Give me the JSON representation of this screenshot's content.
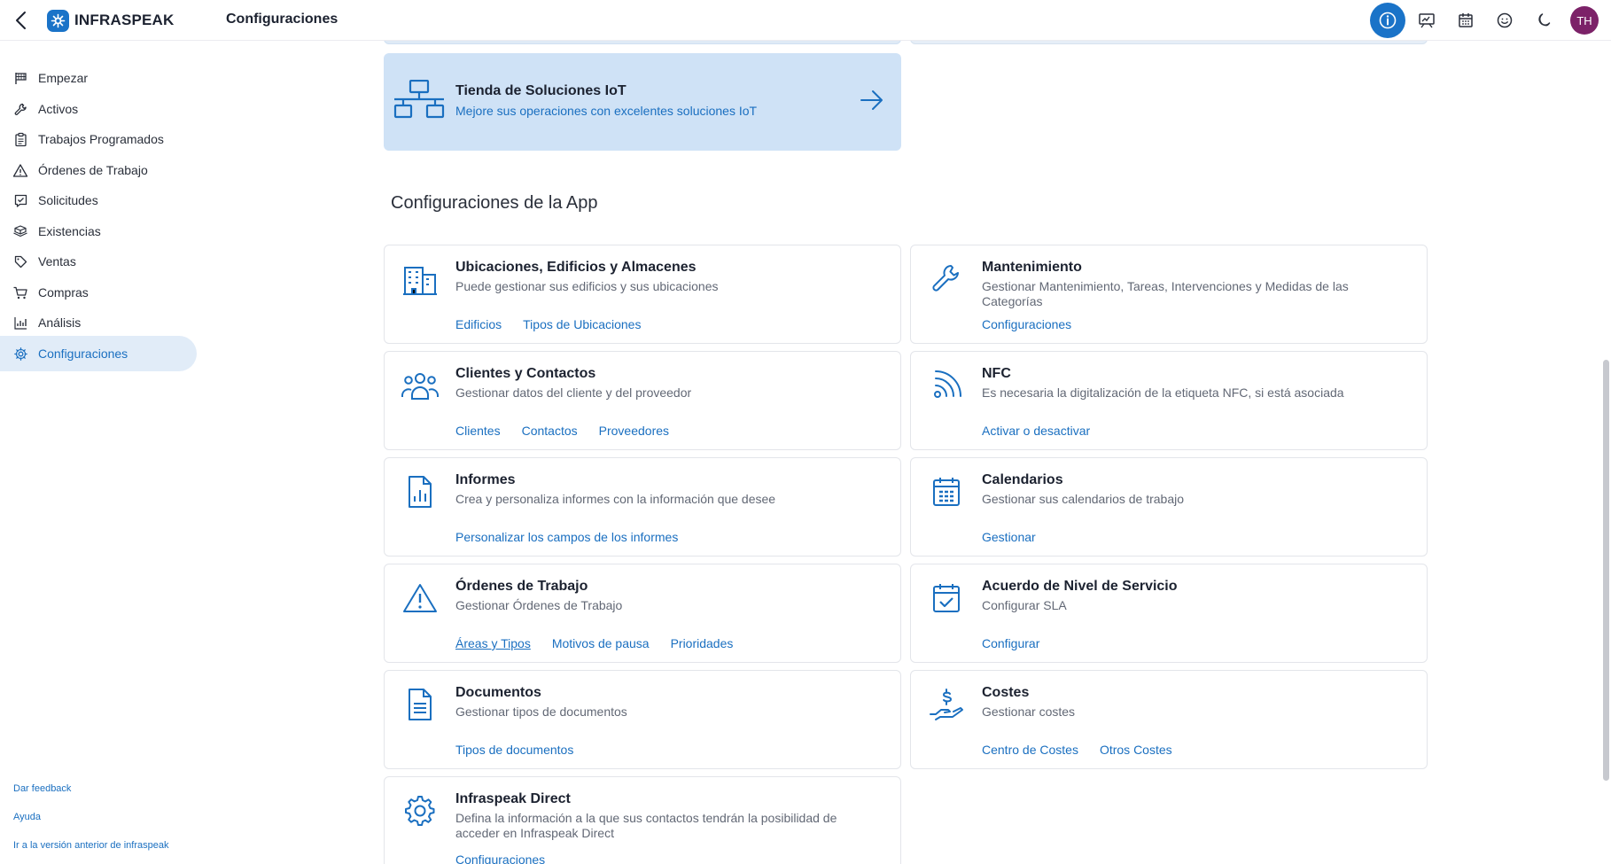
{
  "header": {
    "back_icon": "back-arrow-icon",
    "logo_text": "INFRASPEAK",
    "title": "Configuraciones",
    "avatar_initials": "TH",
    "brand_color": "#1a73c8",
    "avatar_color": "#7c2268"
  },
  "sidebar": {
    "items": [
      {
        "label": "Empezar",
        "icon": "flag-icon"
      },
      {
        "label": "Activos",
        "icon": "wrench-icon"
      },
      {
        "label": "Trabajos Programados",
        "icon": "clipboard-icon"
      },
      {
        "label": "Órdenes de Trabajo",
        "icon": "warning-icon"
      },
      {
        "label": "Solicitudes",
        "icon": "request-icon"
      },
      {
        "label": "Existencias",
        "icon": "boxes-icon"
      },
      {
        "label": "Ventas",
        "icon": "tag-icon"
      },
      {
        "label": "Compras",
        "icon": "cart-icon"
      },
      {
        "label": "Análisis",
        "icon": "chart-icon"
      },
      {
        "label": "Configuraciones",
        "icon": "gear-icon",
        "active": true
      }
    ],
    "footer": {
      "feedback": "Dar feedback",
      "help": "Ayuda",
      "old_version": "Ir a la versión anterior de infraspeak"
    }
  },
  "iot": {
    "title": "Tienda de Soluciones IoT",
    "description": "Mejore sus operaciones con excelentes soluciones IoT"
  },
  "section_title": "Configuraciones de la App",
  "cards": {
    "locations": {
      "title": "Ubicaciones, Edificios y Almacenes",
      "description": "Puede gestionar sus edificios y sus ubicaciones",
      "links": [
        "Edificios",
        "Tipos de Ubicaciones"
      ]
    },
    "maintenance": {
      "title": "Mantenimiento",
      "description": "Gestionar Mantenimiento, Tareas, Intervenciones y Medidas de las Categorías",
      "links": [
        "Configuraciones"
      ]
    },
    "clients": {
      "title": "Clientes y Contactos",
      "description": "Gestionar datos del cliente y del proveedor",
      "links": [
        "Clientes",
        "Contactos",
        "Proveedores"
      ]
    },
    "nfc": {
      "title": "NFC",
      "description": "Es necesaria la digitalización de la etiqueta NFC, si está asociada",
      "links": [
        "Activar o desactivar"
      ]
    },
    "reports": {
      "title": "Informes",
      "description": "Crea y personaliza informes con la información que desee",
      "links": [
        "Personalizar los campos de los informes"
      ]
    },
    "calendars": {
      "title": "Calendarios",
      "description": "Gestionar sus calendarios de trabajo",
      "links": [
        "Gestionar"
      ]
    },
    "work_orders": {
      "title": "Órdenes de Trabajo",
      "description": "Gestionar Órdenes de Trabajo",
      "links": [
        "Áreas y Tipos",
        "Motivos de pausa",
        "Prioridades"
      ]
    },
    "sla": {
      "title": "Acuerdo de Nivel de Servicio",
      "description": "Configurar SLA",
      "links": [
        "Configurar"
      ]
    },
    "documents": {
      "title": "Documentos",
      "description": "Gestionar tipos de documentos",
      "links": [
        "Tipos de documentos"
      ]
    },
    "costs": {
      "title": "Costes",
      "description": "Gestionar costes",
      "links": [
        "Centro de Costes",
        "Otros Costes"
      ]
    },
    "direct": {
      "title": "Infraspeak Direct",
      "description": "Defina la información a la que sus contactos tendrán la posibilidad de acceder en Infraspeak Direct",
      "links": [
        "Configuraciones"
      ]
    }
  }
}
